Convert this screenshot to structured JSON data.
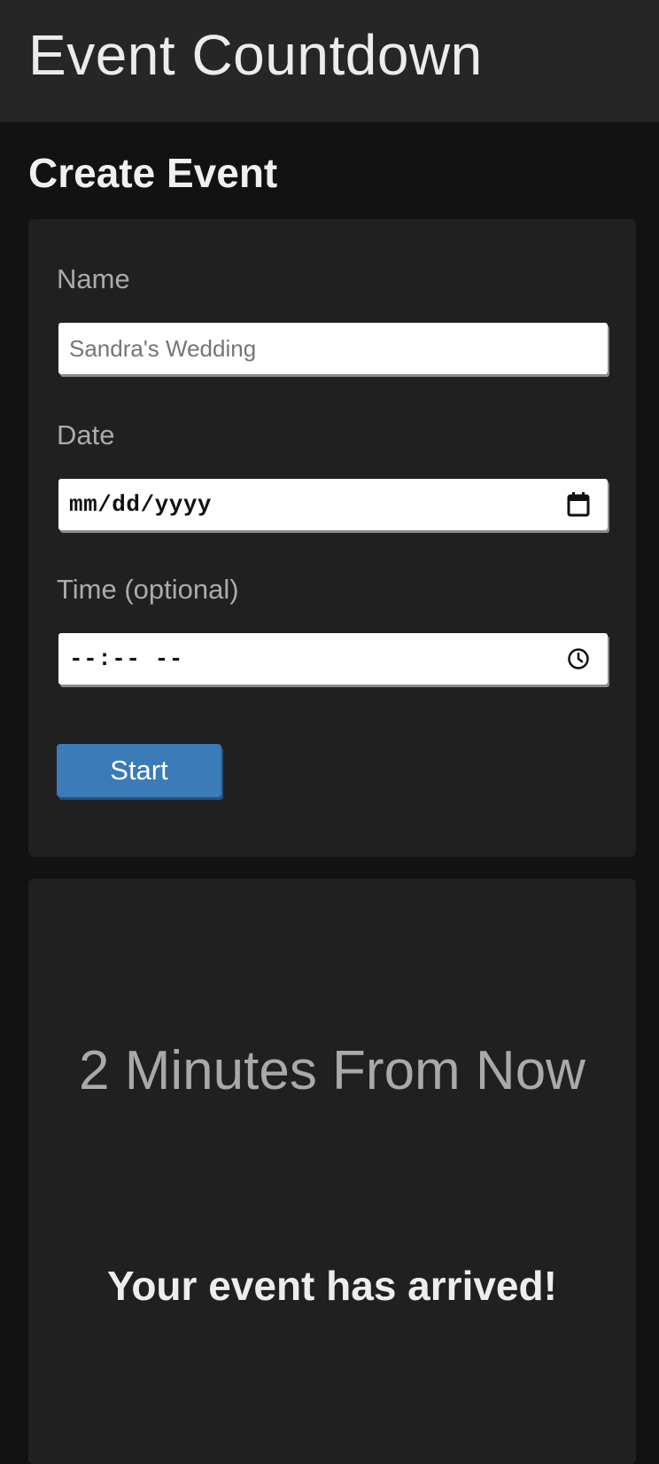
{
  "header": {
    "title": "Event Countdown"
  },
  "create_event": {
    "heading": "Create Event",
    "fields": {
      "name": {
        "label": "Name",
        "value": "Sandra's Wedding"
      },
      "date": {
        "label": "Date",
        "placeholder": "mm/dd/yyyy",
        "icon": "calendar-icon"
      },
      "time": {
        "label": "Time (optional)",
        "placeholder": "--:-- --",
        "icon": "clock-icon"
      }
    },
    "start_label": "Start"
  },
  "countdown": {
    "relative_time": "2 Minutes From Now",
    "message": "Your event has arrived!"
  },
  "colors": {
    "background": "#121212",
    "header": "#262626",
    "card": "#202020",
    "accent": "#3a7bb8"
  }
}
